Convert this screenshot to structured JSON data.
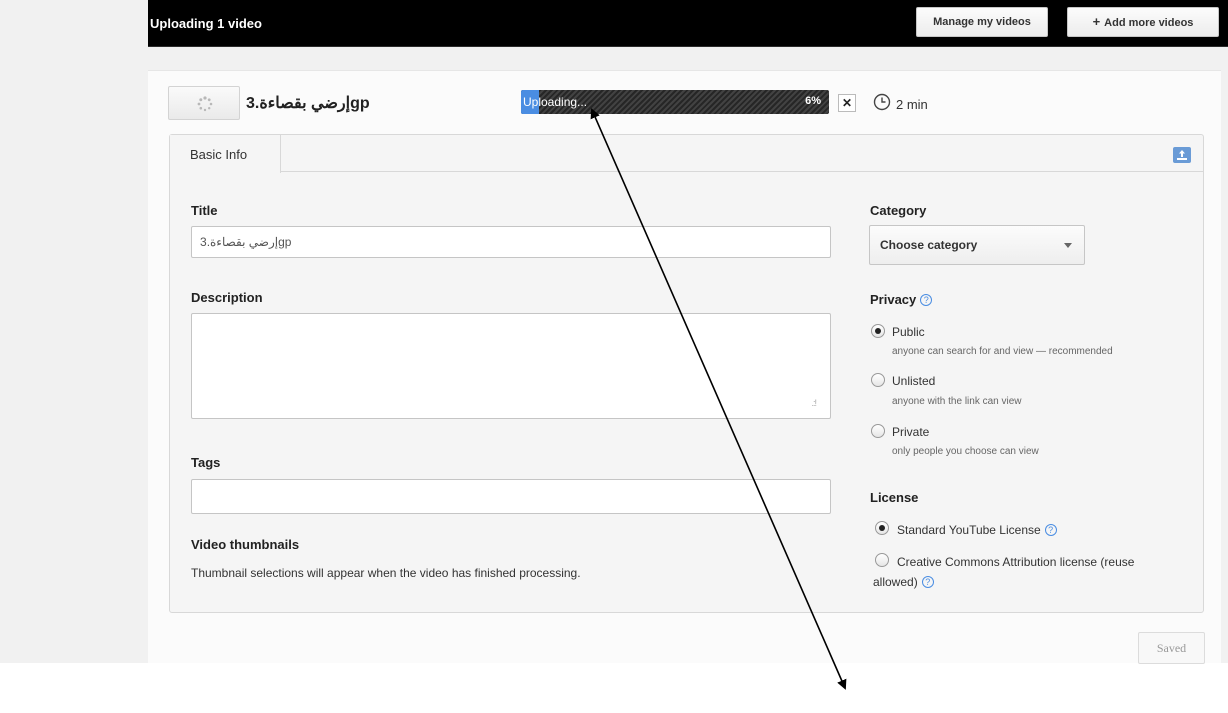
{
  "header": {
    "title": "Uploading 1 video",
    "manage_label": "Manage my videos",
    "add_plus": "+",
    "add_label": "Add more videos"
  },
  "upload": {
    "file_name": "إرضي بقصاءة.3gp",
    "status": "Uploading...",
    "progress_percent": 6,
    "progress_text": "6%",
    "cancel_label": "✕",
    "time_remaining": "2 min"
  },
  "tabs": [
    {
      "label": "Basic Info"
    }
  ],
  "form": {
    "title_label": "Title",
    "title_value": "إرضي بقصاءة.3gp",
    "description_label": "Description",
    "description_value": "",
    "tags_label": "Tags",
    "tags_value": "",
    "thumbnails_label": "Video thumbnails",
    "thumbnails_note": "Thumbnail selections will appear when the video has finished processing."
  },
  "sidebar": {
    "category_label": "Category",
    "category_value": "Choose category",
    "privacy_label": "Privacy",
    "privacy_options": [
      {
        "label": "Public",
        "sub": "anyone can search for and view — recommended",
        "checked": true
      },
      {
        "label": "Unlisted",
        "sub": "anyone with the link can view",
        "checked": false
      },
      {
        "label": "Private",
        "sub": "only people you choose can view",
        "checked": false
      }
    ],
    "license_label": "License",
    "license_options": [
      {
        "label": "Standard YouTube License",
        "checked": true
      },
      {
        "label": "Creative Commons Attribution license (reuse",
        "label_cont": "allowed)",
        "checked": false
      }
    ],
    "help_glyph": "?"
  },
  "footer": {
    "saved_label": "Saved"
  },
  "colors": {
    "progress_fill": "#4a8de2",
    "topbar": "#000000",
    "help_blue": "#4a8de2"
  },
  "icons": [
    "spinner-icon",
    "clock-icon",
    "close-icon",
    "upload-icon",
    "help-icon",
    "chevron-down-icon"
  ]
}
